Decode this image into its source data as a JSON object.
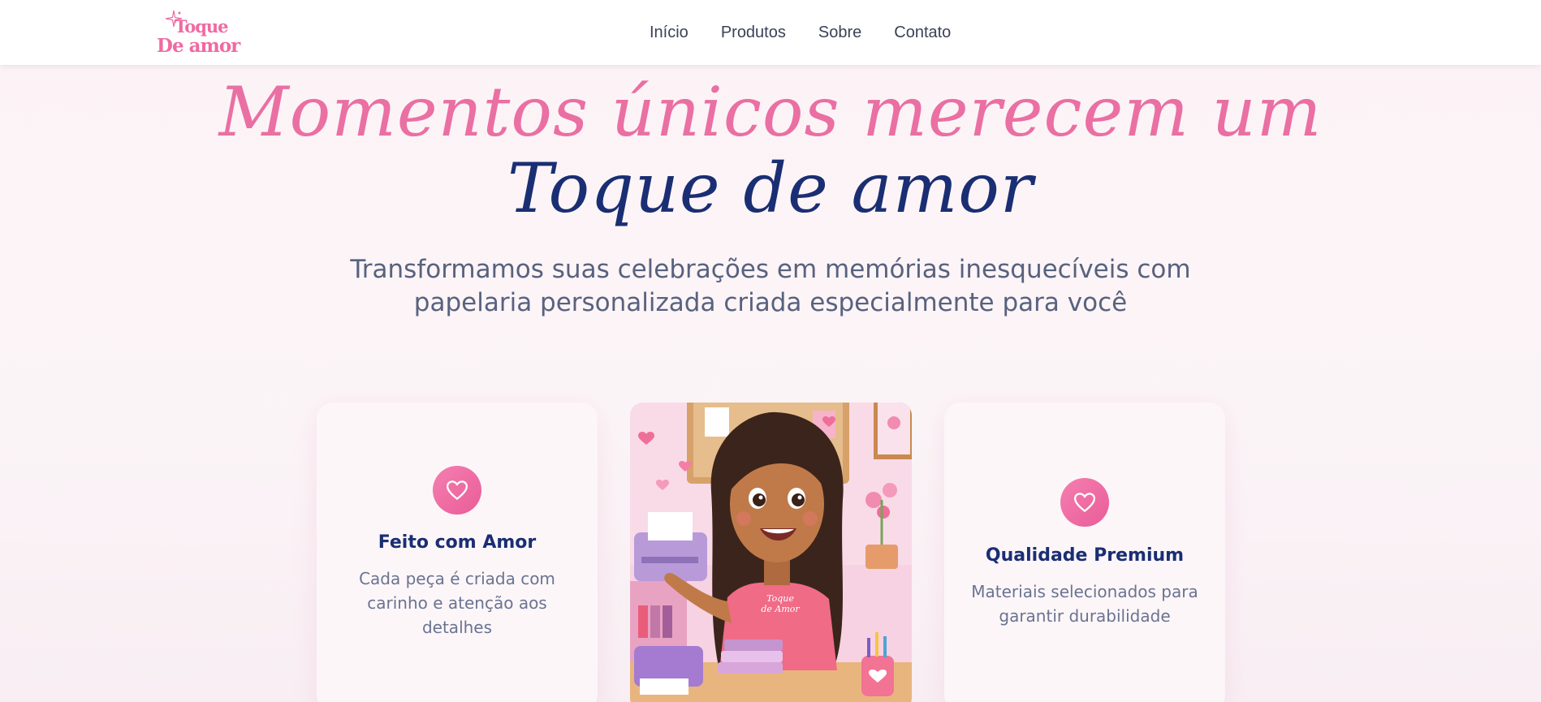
{
  "brand": {
    "logo_line1": "Toque",
    "logo_line2": "De amor",
    "pink": "#ef6aa2",
    "navy": "#1a2e73"
  },
  "nav": {
    "items": [
      "Início",
      "Produtos",
      "Sobre",
      "Contato"
    ]
  },
  "hero": {
    "line1": "Momentos únicos merecem um",
    "line2": "Toque de amor",
    "subtitle_line1": "Transformamos suas celebrações em memórias inesquecíveis com",
    "subtitle_line2": "papelaria personalizada criada especialmente para você"
  },
  "cards": [
    {
      "icon": "heart-icon",
      "title": "Feito com Amor",
      "text": "Cada peça é criada com carinho e atenção aos detalhes"
    },
    {
      "icon": "heart-icon",
      "title": "Qualidade Premium",
      "text": "Materiais selecionados para garantir durabilidade"
    }
  ],
  "illustration": {
    "shirt_text_line1": "Toque",
    "shirt_text_line2": "de Amor"
  }
}
